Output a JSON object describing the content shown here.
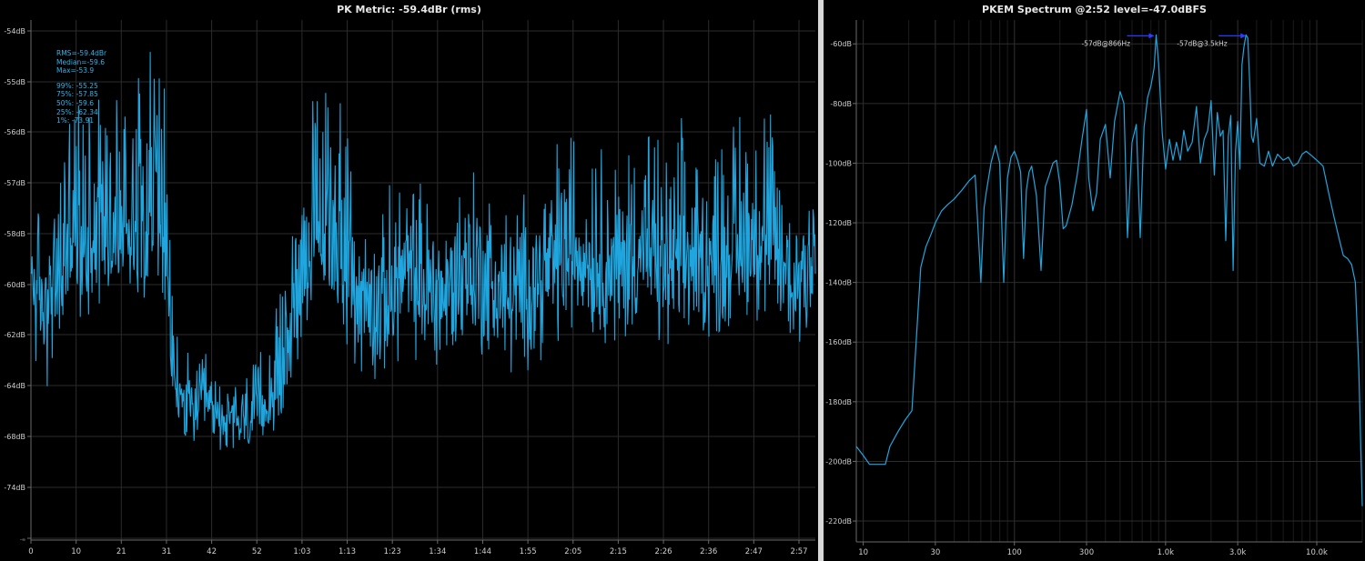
{
  "chart_data": [
    {
      "type": "line",
      "title": "PK Metric: -59.4dBr (rms)",
      "ytick_labels": [
        "-54dB",
        "-55dB",
        "-56dB",
        "-57dB",
        "-58dB",
        "-60dB",
        "-62dB",
        "-64dB",
        "-68dB",
        "-74dB",
        "-∞"
      ],
      "xtick_labels": [
        "0",
        "10",
        "21",
        "31",
        "42",
        "52",
        "1:03",
        "1:13",
        "1:23",
        "1:34",
        "1:44",
        "1:55",
        "2:05",
        "2:15",
        "2:26",
        "2:36",
        "2:47",
        "2:57"
      ],
      "xlim_seconds": [
        0,
        180
      ],
      "grid": true,
      "stats": {
        "rms": "RMS=-59.4dBr",
        "median": "Median=-59.6",
        "max": "Max=-53.9",
        "p99": "99%: -55.25",
        "p75": "75%: -57.85",
        "p50": "50%: -59.6",
        "p25": "25%: -62.34",
        "p1": "1%: -73.91"
      },
      "series_color": "#1fa6df",
      "envelope_seconds": [
        0,
        3,
        6,
        9,
        12,
        15,
        20,
        25,
        30,
        33,
        36,
        40,
        45,
        50,
        55,
        58,
        62,
        66,
        70,
        75,
        80,
        85,
        90,
        95,
        100,
        105,
        110,
        115,
        120,
        125,
        130,
        135,
        140,
        145,
        150,
        155,
        160,
        165,
        170,
        175,
        180
      ],
      "envelope_db_center": [
        -59.5,
        -61,
        -60,
        -58,
        -58.5,
        -57.5,
        -58,
        -57.3,
        -57,
        -64,
        -66,
        -65.5,
        -67,
        -66.5,
        -65,
        -63,
        -59,
        -58.2,
        -57.8,
        -60.5,
        -61,
        -59.5,
        -60,
        -60.5,
        -59.2,
        -60,
        -60.5,
        -60,
        -59.2,
        -58.7,
        -59,
        -59.5,
        -58.5,
        -59.5,
        -59,
        -59.2,
        -58.8,
        -58.2,
        -58.5,
        -60,
        -58.5
      ]
    },
    {
      "type": "line",
      "title": "PKEM Spectrum @2:52 level=-47.0dBFS",
      "x_scale": "log",
      "xlim_hz": [
        9,
        20000
      ],
      "ylim": [
        -227,
        -52
      ],
      "grid": true,
      "ytick_labels": [
        "-60dB",
        "-80dB",
        "-100dB",
        "-120dB",
        "-140dB",
        "-160dB",
        "-180dB",
        "-200dB",
        "-220dB"
      ],
      "ytick_values": [
        -60,
        -80,
        -100,
        -120,
        -140,
        -160,
        -180,
        -200,
        -220
      ],
      "xtick_labels": [
        "10",
        "30",
        "100",
        "300",
        "1.0k",
        "3.0k",
        "10.0k"
      ],
      "xtick_values": [
        10,
        30,
        100,
        300,
        1000,
        3000,
        10000
      ],
      "annotations": [
        {
          "text": "-57dB@866Hz",
          "x_hz": 866,
          "y_db": -57
        },
        {
          "text": "-57dB@3.5kHz",
          "x_hz": 3500,
          "y_db": -57
        }
      ],
      "series_color": "#1fa6df",
      "x_hz": [
        9,
        10,
        11,
        12,
        13,
        14,
        15,
        17,
        19,
        21,
        24,
        26,
        28,
        30,
        33,
        36,
        40,
        45,
        50,
        55,
        60,
        63,
        65,
        67,
        70,
        75,
        80,
        85,
        90,
        95,
        100,
        105,
        110,
        115,
        120,
        125,
        130,
        140,
        150,
        160,
        170,
        180,
        190,
        200,
        210,
        220,
        240,
        260,
        280,
        300,
        310,
        330,
        350,
        370,
        400,
        430,
        460,
        500,
        530,
        560,
        600,
        640,
        680,
        720,
        760,
        800,
        840,
        866,
        900,
        950,
        1000,
        1060,
        1120,
        1180,
        1250,
        1320,
        1400,
        1500,
        1600,
        1700,
        1800,
        1900,
        2000,
        2100,
        2200,
        2300,
        2400,
        2500,
        2600,
        2700,
        2800,
        2900,
        3000,
        3100,
        3200,
        3300,
        3400,
        3500,
        3600,
        3700,
        3800,
        4000,
        4200,
        4500,
        4800,
        5100,
        5500,
        6000,
        6500,
        7000,
        7500,
        8000,
        8500,
        9000,
        10000,
        11000,
        12000,
        13000,
        14000,
        15000,
        16000,
        17000,
        18000,
        19000,
        20000
      ],
      "y_db": [
        -195,
        -198,
        -201,
        -201,
        -201,
        -201,
        -195,
        -190,
        -186,
        -183,
        -135,
        -128,
        -124,
        -120,
        -116,
        -114,
        -112,
        -109,
        -106,
        -104,
        -140,
        -115,
        -110,
        -106,
        -100,
        -94,
        -100,
        -140,
        -105,
        -98,
        -96,
        -99,
        -103,
        -132,
        -109,
        -103,
        -101,
        -111,
        -136,
        -108,
        -104,
        -100,
        -99,
        -107,
        -122,
        -121,
        -114,
        -104,
        -92,
        -82,
        -105,
        -116,
        -110,
        -92,
        -87,
        -105,
        -86,
        -76,
        -80,
        -125,
        -93,
        -87,
        -125,
        -88,
        -78,
        -74,
        -68,
        -57,
        -67,
        -90,
        -102,
        -92,
        -99,
        -93,
        -99,
        -89,
        -96,
        -93,
        -81,
        -100,
        -92,
        -89,
        -79,
        -104,
        -83,
        -91,
        -89,
        -126,
        -91,
        -84,
        -136,
        -96,
        -86,
        -102,
        -67,
        -61,
        -57,
        -58,
        -73,
        -91,
        -93,
        -85,
        -100,
        -101,
        -96,
        -101,
        -97,
        -99,
        -98,
        -101,
        -100,
        -97,
        -96,
        -97,
        -99,
        -101,
        -110,
        -118,
        -125,
        -131,
        -132,
        -134,
        -140,
        -170,
        -215
      ]
    }
  ]
}
